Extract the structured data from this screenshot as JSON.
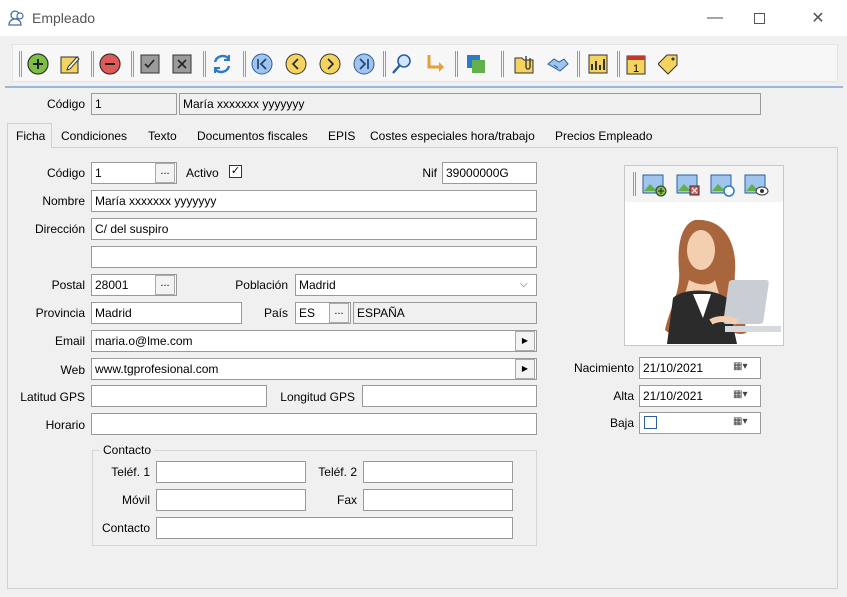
{
  "window": {
    "title": "Empleado"
  },
  "toolbar": {
    "buttons": [
      "add-icon",
      "edit-icon",
      "delete-icon",
      "accept-icon",
      "cancel-icon",
      "refresh-icon",
      "first-icon",
      "prev-icon",
      "next-icon",
      "last-icon",
      "search-icon",
      "goto-icon",
      "copy-icon",
      "attach-icon",
      "handshake-icon",
      "report-icon",
      "calendar-icon",
      "tags-icon"
    ],
    "calendar_day": "1"
  },
  "header": {
    "codigo_label": "Código",
    "codigo": "1",
    "nombre": "María xxxxxxx yyyyyyy"
  },
  "tabs": [
    "Ficha",
    "Condiciones",
    "Texto",
    "Documentos fiscales",
    "EPIS",
    "Costes especiales hora/trabajo",
    "Precios Empleado"
  ],
  "form": {
    "codigo_label": "Código",
    "codigo": "1",
    "dots": "...",
    "activo_label": "Activo",
    "nif_label": "Nif",
    "nif": "39000000G",
    "nombre_label": "Nombre",
    "nombre": "María xxxxxxx yyyyyyy",
    "direccion_label": "Dirección",
    "direccion1": "C/ del suspiro",
    "direccion2": "",
    "postal_label": "Postal",
    "postal": "28001",
    "poblacion_label": "Población",
    "poblacion": "Madrid",
    "provincia_label": "Provincia",
    "provincia": "Madrid",
    "pais_label": "País",
    "pais_code": "ES",
    "pais_name": "ESPAÑA",
    "email_label": "Email",
    "email": "maria.o@lme.com",
    "web_label": "Web",
    "web": "www.tgprofesional.com",
    "latitud_label": "Latitud GPS",
    "latitud": "",
    "longitud_label": "Longitud GPS",
    "longitud": "",
    "horario_label": "Horario",
    "horario": ""
  },
  "contacto": {
    "group_label": "Contacto",
    "telef1_label": "Teléf. 1",
    "telef2_label": "Teléf. 2",
    "movil_label": "Móvil",
    "fax_label": "Fax",
    "contacto_label": "Contacto"
  },
  "dates": {
    "nacimiento_label": "Nacimiento",
    "nacimiento": "21/10/2021",
    "alta_label": "Alta",
    "alta": "21/10/2021",
    "baja_label": "Baja",
    "baja": ""
  }
}
